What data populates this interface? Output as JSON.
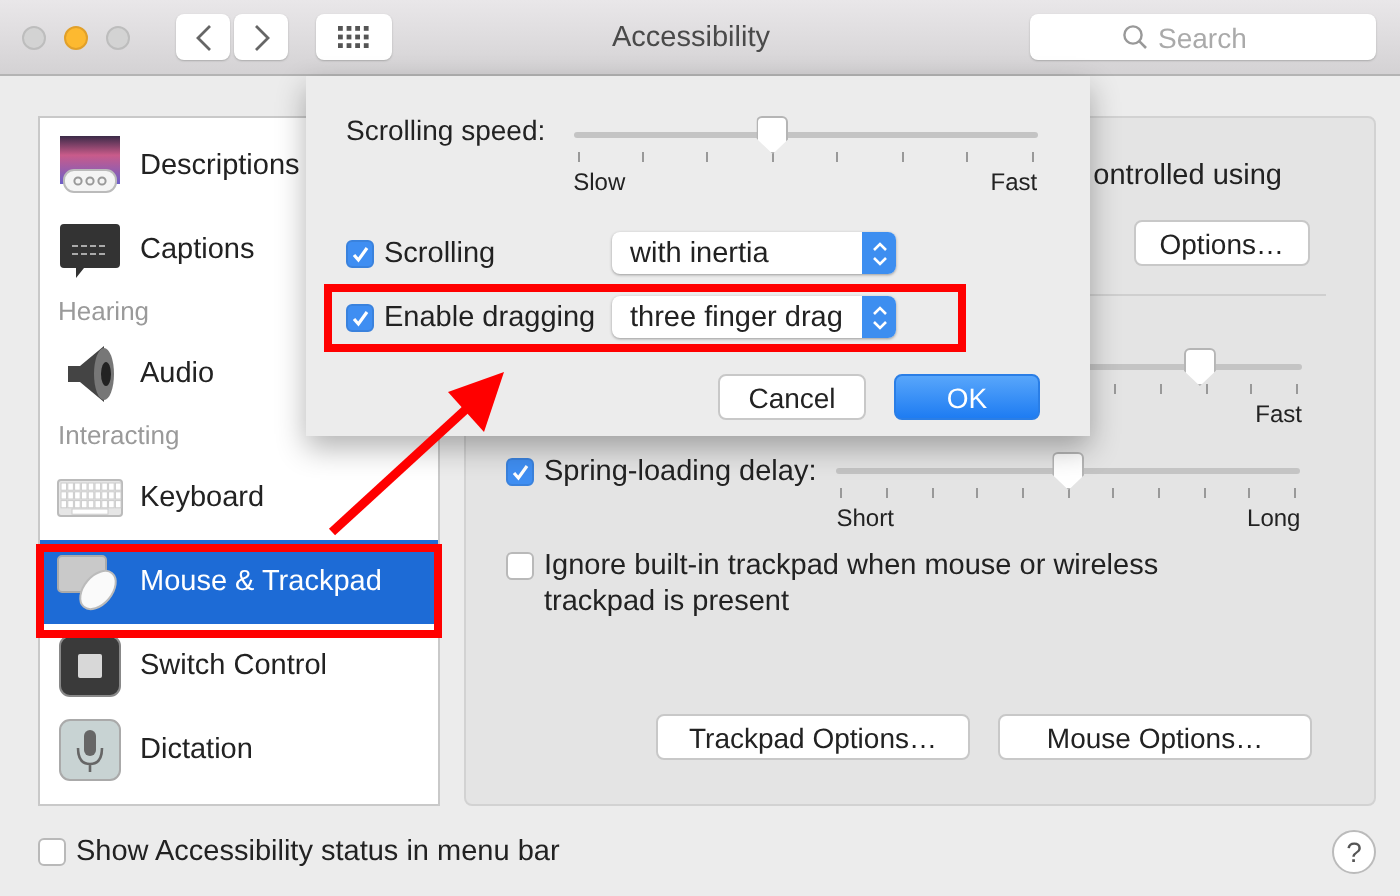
{
  "window": {
    "title": "Accessibility",
    "search": {
      "placeholder": "Search"
    }
  },
  "sidebar": {
    "items": [
      {
        "kind": "item",
        "label": "Descriptions",
        "selected": false
      },
      {
        "kind": "item",
        "label": "Captions",
        "selected": false
      },
      {
        "kind": "header",
        "label": "Hearing"
      },
      {
        "kind": "item",
        "label": "Audio",
        "selected": false
      },
      {
        "kind": "header",
        "label": "Interacting"
      },
      {
        "kind": "item",
        "label": "Keyboard",
        "selected": false
      },
      {
        "kind": "item",
        "label": "Mouse & Trackpad",
        "selected": true
      },
      {
        "kind": "item",
        "label": "Switch Control",
        "selected": false
      },
      {
        "kind": "item",
        "label": "Dictation",
        "selected": false
      }
    ]
  },
  "panel": {
    "partial_text": "ontrolled using",
    "options_button": "Options…",
    "speed_slider": {
      "level": 0.78,
      "max_label": "Fast"
    },
    "spring_loading": {
      "label": "Spring-loading delay:",
      "checked": true,
      "level": 0.5,
      "min_label": "Short",
      "max_label": "Long"
    },
    "ignore_trackpad": {
      "label": "Ignore built-in trackpad when mouse or wireless trackpad is present",
      "checked": false
    },
    "buttons": [
      "Trackpad Options…",
      "Mouse Options…"
    ]
  },
  "status_checkbox": {
    "label": "Show Accessibility status in menu bar",
    "checked": false
  },
  "help_button": "?",
  "sheet": {
    "scrolling_speed": {
      "label": "Scrolling speed:",
      "level": 0.43,
      "min_label": "Slow",
      "max_label": "Fast"
    },
    "options": [
      {
        "label": "Scrolling",
        "checked": true,
        "value": "with inertia"
      },
      {
        "label": "Enable dragging",
        "checked": true,
        "value": "three finger drag"
      }
    ],
    "cancel": "Cancel",
    "ok": "OK"
  }
}
